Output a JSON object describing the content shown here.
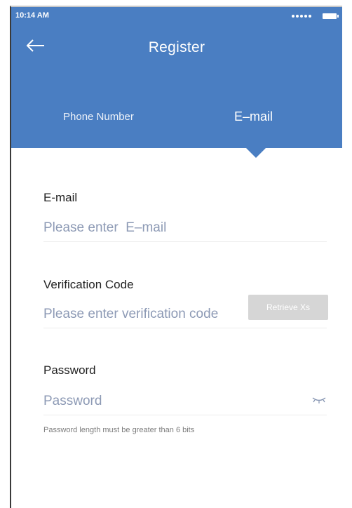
{
  "status_bar": {
    "time": "10:14 AM"
  },
  "header": {
    "title": "Register",
    "back_icon": "arrow-left-icon",
    "background_color": "#4a7ec2"
  },
  "tabs": [
    {
      "label": "Phone Number",
      "selected": false
    },
    {
      "label": "E–mail",
      "selected": true
    }
  ],
  "form": {
    "email": {
      "label": "E-mail",
      "placeholder": "Please enter  E–mail",
      "value": ""
    },
    "verification": {
      "label": "Verification Code",
      "placeholder": "Please enter verification code",
      "value": "",
      "button_label": "Retrieve Xs"
    },
    "password": {
      "label": "Password",
      "placeholder": "Password",
      "value": "",
      "toggle_icon": "eye-closed-icon",
      "hint": "Password length must be greater than 6 bits"
    }
  }
}
